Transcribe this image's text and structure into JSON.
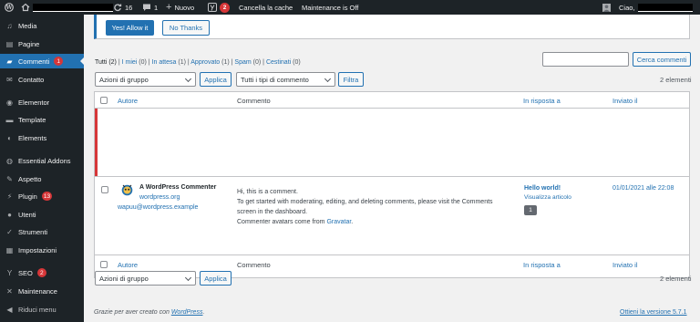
{
  "adminbar": {
    "updates_count": "16",
    "comments_count": "1",
    "new_label": "Nuovo",
    "yoast_badge": "2",
    "clear_cache": "Cancella la cache",
    "maintenance": "Maintenance is Off",
    "greeting": "Ciao,"
  },
  "sidebar": {
    "items": [
      {
        "label": "Media",
        "icon": "media-icon"
      },
      {
        "label": "Pagine",
        "icon": "pages-icon"
      },
      {
        "label": "Commenti",
        "icon": "comments-icon",
        "badge": "1",
        "current": true
      },
      {
        "label": "Contatto",
        "icon": "mail-icon"
      },
      {
        "label": "Elementor",
        "icon": "elementor-icon"
      },
      {
        "label": "Template",
        "icon": "folder-icon"
      },
      {
        "label": "Elements",
        "icon": "elements-icon"
      },
      {
        "label": "Essential Addons",
        "icon": "addons-icon"
      },
      {
        "label": "Aspetto",
        "icon": "brush-icon"
      },
      {
        "label": "Plugin",
        "icon": "plugin-icon",
        "badge": "13"
      },
      {
        "label": "Utenti",
        "icon": "users-icon"
      },
      {
        "label": "Strumenti",
        "icon": "wrench-icon"
      },
      {
        "label": "Impostazioni",
        "icon": "settings-icon"
      },
      {
        "label": "SEO",
        "icon": "yoast-icon",
        "badge": "2"
      },
      {
        "label": "Maintenance",
        "icon": "maintenance-icon"
      },
      {
        "label": "Riduci menu",
        "icon": "collapse-icon"
      }
    ]
  },
  "notice": {
    "allow_label": "Yes! Allow it",
    "no_label": "No Thanks"
  },
  "filters": {
    "all": "Tutti",
    "all_count": "(2)",
    "mine": "I miei",
    "mine_count": "(0)",
    "pending": "In attesa",
    "pending_count": "(1)",
    "approved": "Approvato",
    "approved_count": "(1)",
    "spam": "Spam",
    "spam_count": "(0)",
    "trash": "Cestinati",
    "trash_count": "(0)"
  },
  "search": {
    "button": "Cerca commenti",
    "value": ""
  },
  "bulk": {
    "select": "Azioni di gruppo",
    "apply": "Applica",
    "type_select": "Tutti i tipi di commento",
    "filter": "Filtra",
    "count": "2 elementi"
  },
  "table": {
    "columns": {
      "author": "Autore",
      "comment": "Commento",
      "response": "In risposta a",
      "sent": "Inviato il"
    },
    "row": {
      "author_name": "A WordPress Commenter",
      "author_url": "wordpress.org",
      "author_email": "wapuu@wordpress.example",
      "comment_lines": [
        "Hi, this is a comment.",
        "To get started with moderating, editing, and deleting comments, please visit the Comments",
        "screen in the dashboard."
      ],
      "avatar_line_prefix": "Commenter avatars come from",
      "avatar_link": "Gravatar",
      "avatar_line_suffix": ".",
      "post_title": "Hello world!",
      "view_post": "Visualizza articolo",
      "post_comments": "1",
      "date": "01/01/2021 alle 22:08"
    }
  },
  "bottom": {
    "select": "Azioni di gruppo",
    "apply": "Applica",
    "count": "2 elementi"
  },
  "footer": {
    "thanks_prefix": "Grazie per aver creato con",
    "wordpress_link": "WordPress",
    "thanks_suffix": ".",
    "version": "Ottieni la versione 5.7.1"
  }
}
